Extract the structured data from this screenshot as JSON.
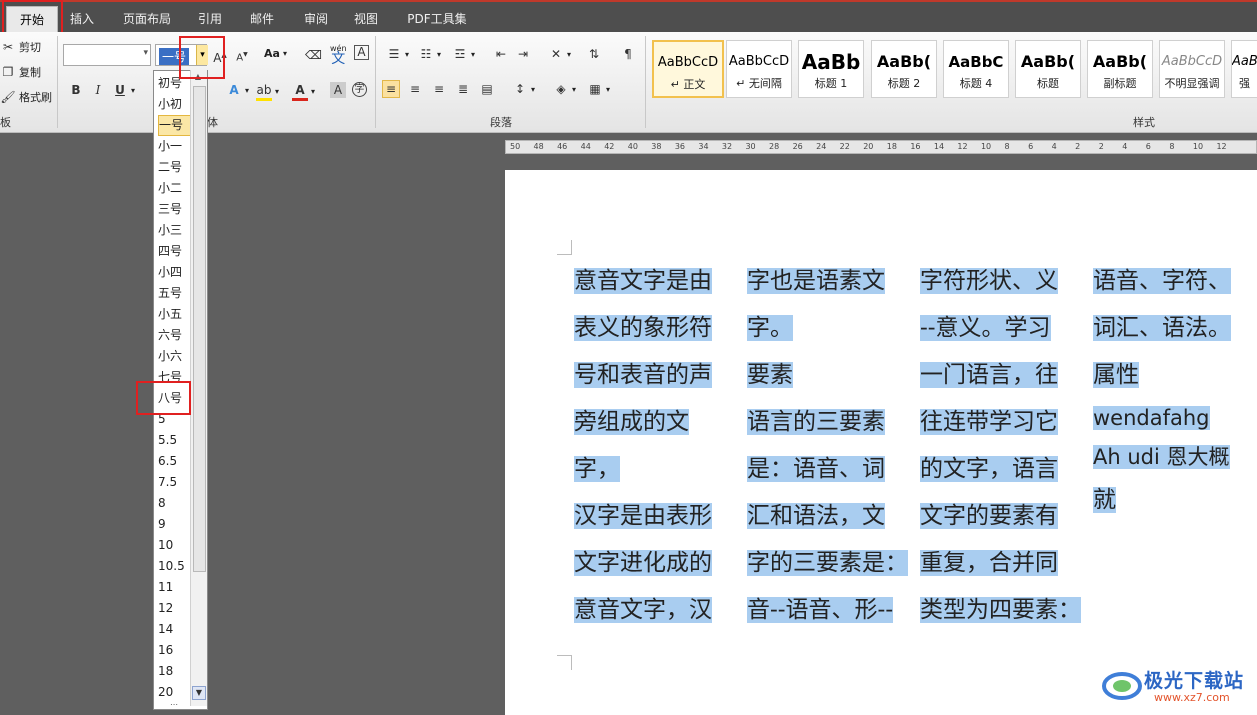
{
  "tabs": [
    "开始",
    "插入",
    "页面布局",
    "引用",
    "邮件",
    "审阅",
    "视图",
    "PDF工具集"
  ],
  "clipboard": {
    "cut": "剪切",
    "copy": "复制",
    "format_painter": "格式刷",
    "group_label": "板"
  },
  "font": {
    "size_value": "一号",
    "group_label": "体",
    "aa_label": "Aa",
    "wen_label": "wén",
    "wen_char": "文"
  },
  "paragraph": {
    "group_label": "段落"
  },
  "styles": {
    "group_label": "样式",
    "items": [
      {
        "sample": "AaBbCcD",
        "name": "↵ 正文"
      },
      {
        "sample": "AaBbCcD",
        "name": "↵ 无间隔"
      },
      {
        "sample": "AaBb",
        "name": "标题 1"
      },
      {
        "sample": "AaBb(",
        "name": "标题 2"
      },
      {
        "sample": "AaBbC",
        "name": "标题 4"
      },
      {
        "sample": "AaBb(",
        "name": "标题"
      },
      {
        "sample": "AaBb(",
        "name": "副标题"
      },
      {
        "sample": "AaBbCcD",
        "name": "不明显强调"
      },
      {
        "sample": "AaBb",
        "name": "强"
      }
    ]
  },
  "ruler": {
    "ticks": [
      "50",
      "48",
      "46",
      "44",
      "42",
      "40",
      "38",
      "36",
      "34",
      "32",
      "30",
      "28",
      "26",
      "24",
      "22",
      "20",
      "18",
      "16",
      "14",
      "12",
      "10",
      "8",
      "6",
      "4",
      "2",
      "2",
      "4",
      "6",
      "8",
      "10",
      "12"
    ]
  },
  "font_size_list": {
    "items": [
      "初号",
      "小初",
      "一号",
      "小一",
      "二号",
      "小二",
      "三号",
      "小三",
      "四号",
      "小四",
      "五号",
      "小五",
      "六号",
      "小六",
      "七号",
      "八号",
      "5",
      "5.5",
      "6.5",
      "7.5",
      "8",
      "9",
      "10",
      "10.5",
      "11",
      "12",
      "14",
      "16",
      "18",
      "20"
    ],
    "selected": "一号"
  },
  "document": {
    "columns": [
      [
        "意音文字是由",
        "表义的象形符",
        "号和表音的声",
        "旁组成的文字，",
        "汉字是由表形",
        "文字进化成的",
        "意音文字，汉"
      ],
      [
        "字也是语素文",
        "字。",
        "要素",
        "语言的三要素",
        "是：语音、词",
        "汇和语法，文",
        "字的三要素是：",
        "音--语音、形--"
      ],
      [
        "字符形状、义",
        "--意义。学习",
        "一门语言，往",
        "往连带学习它",
        "的文字，语言",
        "文字的要素有",
        "重复，合并同",
        "类型为四要素："
      ],
      [
        "语音、字符、",
        "词汇、语法。",
        "属性",
        "wendafahg",
        "Ah udi 恩大概",
        "就"
      ]
    ]
  },
  "watermark": {
    "brand": "极光下载站",
    "url": "www.xz7.com"
  }
}
